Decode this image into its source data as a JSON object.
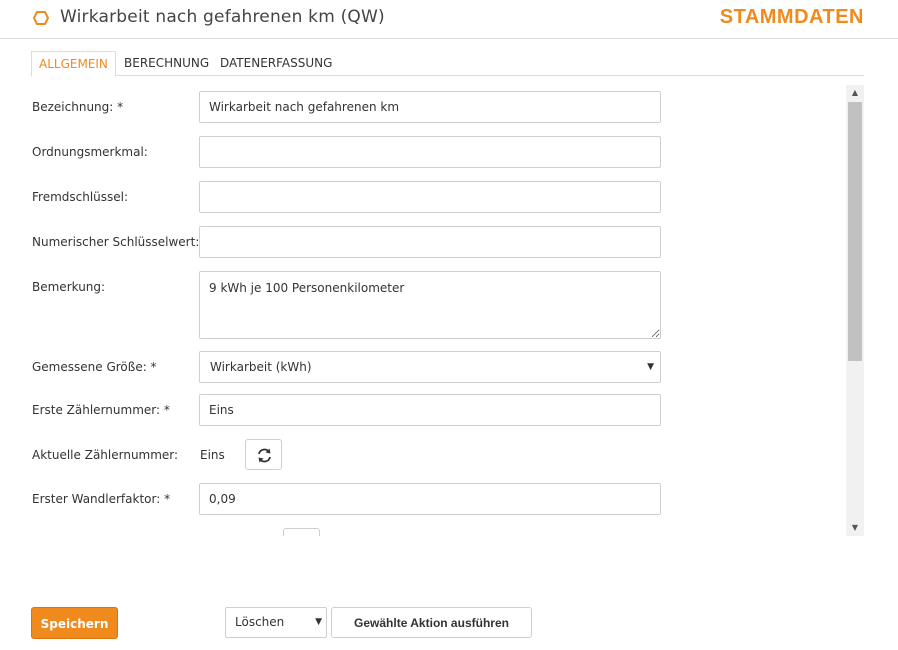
{
  "header": {
    "title": "Wirkarbeit nach gefahrenen km (QW)",
    "brand": "STAMMDATEN",
    "accent_color": "#f08a1c",
    "title_icon": "hexagon-icon"
  },
  "tabs": [
    {
      "label": "ALLGEMEIN",
      "active": true
    },
    {
      "label": "BERECHNUNG",
      "active": false
    },
    {
      "label": "DATENERFASSUNG",
      "active": false
    }
  ],
  "form": {
    "bezeichnung": {
      "label": "Bezeichnung: *",
      "value": "Wirkarbeit nach gefahrenen km"
    },
    "ordnungsmerkmal": {
      "label": "Ordnungsmerkmal:",
      "value": ""
    },
    "fremdschluessel": {
      "label": "Fremdschlüssel:",
      "value": ""
    },
    "numerischer_schluesselwert": {
      "label": "Numerischer Schlüsselwert:",
      "value": ""
    },
    "bemerkung": {
      "label": "Bemerkung:",
      "value": "9 kWh je 100 Personenkilometer"
    },
    "gemessene_groesse": {
      "label": "Gemessene Größe: *",
      "value": "Wirkarbeit (kWh)"
    },
    "erste_zaehlernummer": {
      "label": "Erste Zählernummer: *",
      "value": "Eins"
    },
    "aktuelle_zaehlernummer": {
      "label": "Aktuelle Zählernummer:",
      "value": "Eins",
      "button_icon": "refresh-icon"
    },
    "erster_wandlerfaktor": {
      "label": "Erster Wandlerfaktor: *",
      "value": "0,09"
    }
  },
  "footer": {
    "save_label": "Speichern",
    "action_select_value": "Löschen",
    "execute_label": "Gewählte Aktion ausführen"
  }
}
